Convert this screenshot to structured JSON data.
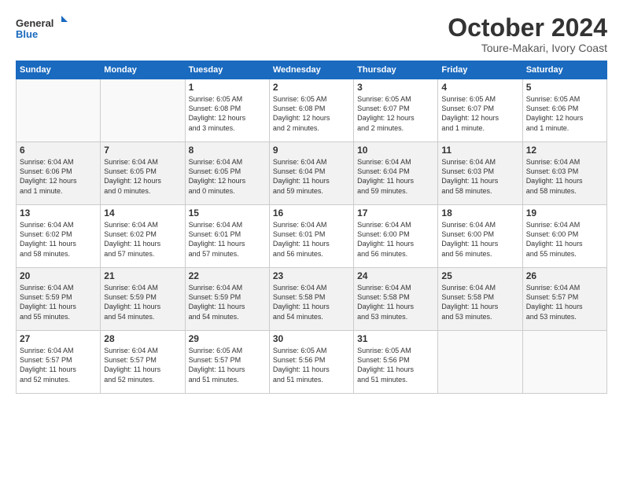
{
  "logo": {
    "line1": "General",
    "line2": "Blue"
  },
  "title": "October 2024",
  "subtitle": "Toure-Makari, Ivory Coast",
  "headers": [
    "Sunday",
    "Monday",
    "Tuesday",
    "Wednesday",
    "Thursday",
    "Friday",
    "Saturday"
  ],
  "weeks": [
    [
      {
        "day": "",
        "info": ""
      },
      {
        "day": "",
        "info": ""
      },
      {
        "day": "1",
        "info": "Sunrise: 6:05 AM\nSunset: 6:08 PM\nDaylight: 12 hours\nand 3 minutes."
      },
      {
        "day": "2",
        "info": "Sunrise: 6:05 AM\nSunset: 6:08 PM\nDaylight: 12 hours\nand 2 minutes."
      },
      {
        "day": "3",
        "info": "Sunrise: 6:05 AM\nSunset: 6:07 PM\nDaylight: 12 hours\nand 2 minutes."
      },
      {
        "day": "4",
        "info": "Sunrise: 6:05 AM\nSunset: 6:07 PM\nDaylight: 12 hours\nand 1 minute."
      },
      {
        "day": "5",
        "info": "Sunrise: 6:05 AM\nSunset: 6:06 PM\nDaylight: 12 hours\nand 1 minute."
      }
    ],
    [
      {
        "day": "6",
        "info": "Sunrise: 6:04 AM\nSunset: 6:06 PM\nDaylight: 12 hours\nand 1 minute."
      },
      {
        "day": "7",
        "info": "Sunrise: 6:04 AM\nSunset: 6:05 PM\nDaylight: 12 hours\nand 0 minutes."
      },
      {
        "day": "8",
        "info": "Sunrise: 6:04 AM\nSunset: 6:05 PM\nDaylight: 12 hours\nand 0 minutes."
      },
      {
        "day": "9",
        "info": "Sunrise: 6:04 AM\nSunset: 6:04 PM\nDaylight: 11 hours\nand 59 minutes."
      },
      {
        "day": "10",
        "info": "Sunrise: 6:04 AM\nSunset: 6:04 PM\nDaylight: 11 hours\nand 59 minutes."
      },
      {
        "day": "11",
        "info": "Sunrise: 6:04 AM\nSunset: 6:03 PM\nDaylight: 11 hours\nand 58 minutes."
      },
      {
        "day": "12",
        "info": "Sunrise: 6:04 AM\nSunset: 6:03 PM\nDaylight: 11 hours\nand 58 minutes."
      }
    ],
    [
      {
        "day": "13",
        "info": "Sunrise: 6:04 AM\nSunset: 6:02 PM\nDaylight: 11 hours\nand 58 minutes."
      },
      {
        "day": "14",
        "info": "Sunrise: 6:04 AM\nSunset: 6:02 PM\nDaylight: 11 hours\nand 57 minutes."
      },
      {
        "day": "15",
        "info": "Sunrise: 6:04 AM\nSunset: 6:01 PM\nDaylight: 11 hours\nand 57 minutes."
      },
      {
        "day": "16",
        "info": "Sunrise: 6:04 AM\nSunset: 6:01 PM\nDaylight: 11 hours\nand 56 minutes."
      },
      {
        "day": "17",
        "info": "Sunrise: 6:04 AM\nSunset: 6:00 PM\nDaylight: 11 hours\nand 56 minutes."
      },
      {
        "day": "18",
        "info": "Sunrise: 6:04 AM\nSunset: 6:00 PM\nDaylight: 11 hours\nand 56 minutes."
      },
      {
        "day": "19",
        "info": "Sunrise: 6:04 AM\nSunset: 6:00 PM\nDaylight: 11 hours\nand 55 minutes."
      }
    ],
    [
      {
        "day": "20",
        "info": "Sunrise: 6:04 AM\nSunset: 5:59 PM\nDaylight: 11 hours\nand 55 minutes."
      },
      {
        "day": "21",
        "info": "Sunrise: 6:04 AM\nSunset: 5:59 PM\nDaylight: 11 hours\nand 54 minutes."
      },
      {
        "day": "22",
        "info": "Sunrise: 6:04 AM\nSunset: 5:59 PM\nDaylight: 11 hours\nand 54 minutes."
      },
      {
        "day": "23",
        "info": "Sunrise: 6:04 AM\nSunset: 5:58 PM\nDaylight: 11 hours\nand 54 minutes."
      },
      {
        "day": "24",
        "info": "Sunrise: 6:04 AM\nSunset: 5:58 PM\nDaylight: 11 hours\nand 53 minutes."
      },
      {
        "day": "25",
        "info": "Sunrise: 6:04 AM\nSunset: 5:58 PM\nDaylight: 11 hours\nand 53 minutes."
      },
      {
        "day": "26",
        "info": "Sunrise: 6:04 AM\nSunset: 5:57 PM\nDaylight: 11 hours\nand 53 minutes."
      }
    ],
    [
      {
        "day": "27",
        "info": "Sunrise: 6:04 AM\nSunset: 5:57 PM\nDaylight: 11 hours\nand 52 minutes."
      },
      {
        "day": "28",
        "info": "Sunrise: 6:04 AM\nSunset: 5:57 PM\nDaylight: 11 hours\nand 52 minutes."
      },
      {
        "day": "29",
        "info": "Sunrise: 6:05 AM\nSunset: 5:57 PM\nDaylight: 11 hours\nand 51 minutes."
      },
      {
        "day": "30",
        "info": "Sunrise: 6:05 AM\nSunset: 5:56 PM\nDaylight: 11 hours\nand 51 minutes."
      },
      {
        "day": "31",
        "info": "Sunrise: 6:05 AM\nSunset: 5:56 PM\nDaylight: 11 hours\nand 51 minutes."
      },
      {
        "day": "",
        "info": ""
      },
      {
        "day": "",
        "info": ""
      }
    ]
  ]
}
